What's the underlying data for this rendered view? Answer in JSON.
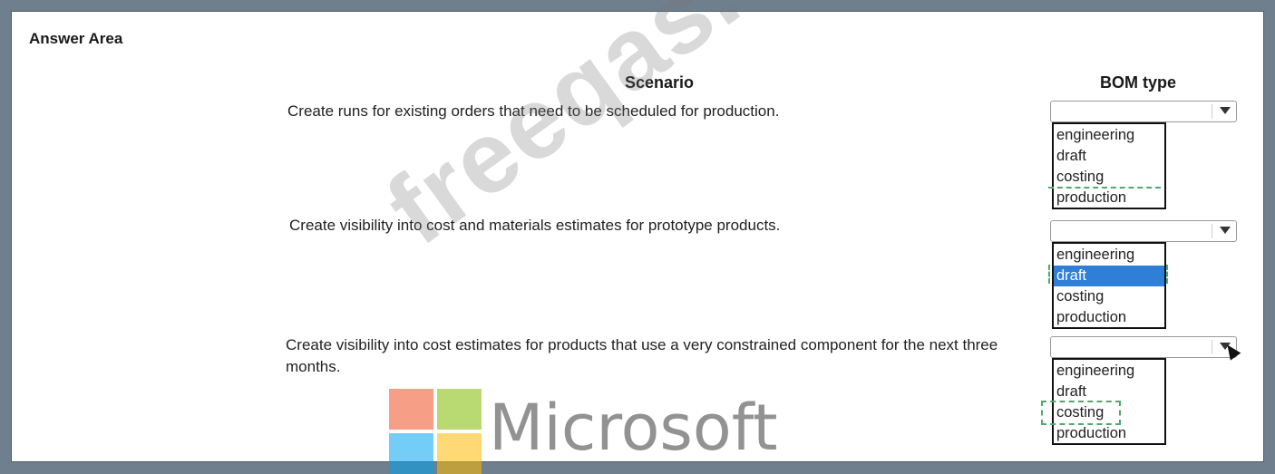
{
  "answer_area_label": "Answer Area",
  "columns": {
    "scenario": "Scenario",
    "bom_type": "BOM type"
  },
  "scenarios": [
    {
      "text": "Create runs for existing orders that need to be scheduled for production.",
      "options": [
        "engineering",
        "draft",
        "costing",
        "production"
      ],
      "marked_option": "production"
    },
    {
      "text": "Create visibility into cost and materials estimates for prototype products.",
      "options": [
        "engineering",
        "draft",
        "costing",
        "production"
      ],
      "marked_option": "draft"
    },
    {
      "text": "Create visibility into cost estimates for products that use a very constrained component for the next three months.",
      "options": [
        "engineering",
        "draft",
        "costing",
        "production"
      ],
      "marked_option": "costing"
    }
  ],
  "watermark": {
    "text": "freeqas.com",
    "brand": "Microsoft"
  },
  "colors": {
    "selected_option": "#2f7fd8",
    "answer_marker": "#4fa96b",
    "frame": "#6f7f8e"
  },
  "icons": [
    "dropdown-arrow-icon",
    "mouse-cursor-icon",
    "microsoft-logo-icon"
  ]
}
